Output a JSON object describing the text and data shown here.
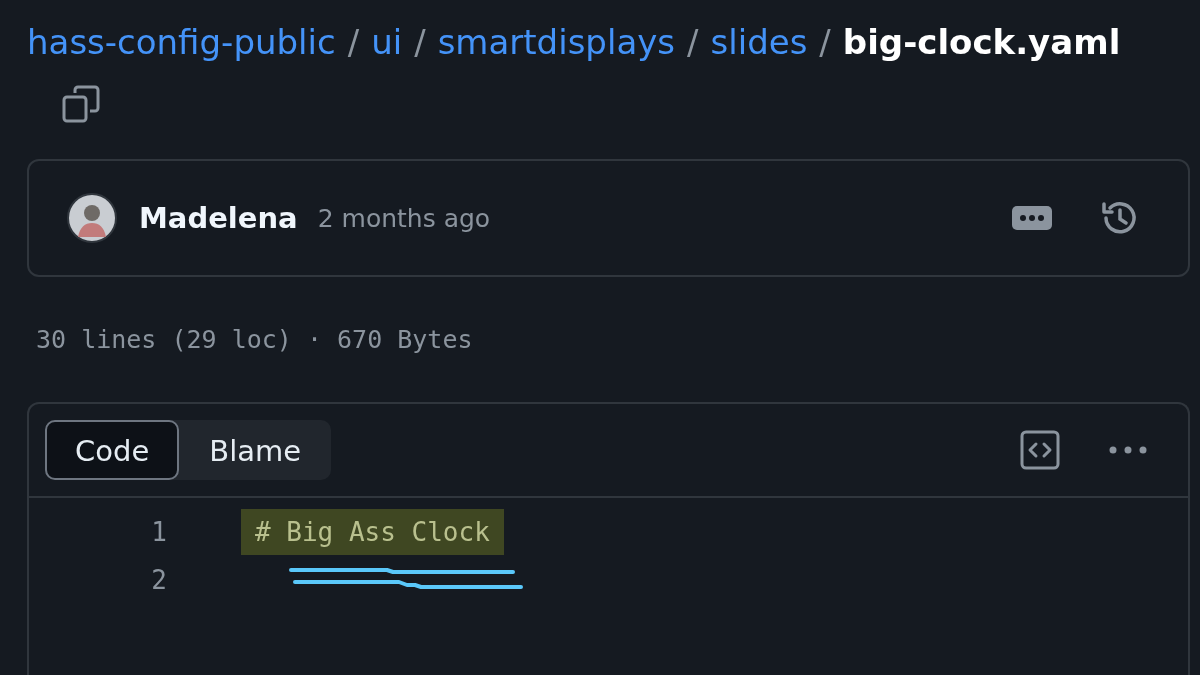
{
  "breadcrumb": {
    "path": [
      {
        "label": "hass-config-public"
      },
      {
        "label": "ui"
      },
      {
        "label": "smartdisplays"
      },
      {
        "label": "slides"
      }
    ],
    "separator": "/",
    "file_name": "big-clock.yaml"
  },
  "commit": {
    "author": "Madelena",
    "time": "2 months ago"
  },
  "file_info": "30 lines (29 loc) · 670 Bytes",
  "tabs": [
    {
      "label": "Code",
      "selected": true
    },
    {
      "label": "Blame",
      "selected": false
    }
  ],
  "code_lines": [
    {
      "number": "1",
      "text": "# Big Ass Clock",
      "highlighted": true
    },
    {
      "number": "2"
    }
  ]
}
